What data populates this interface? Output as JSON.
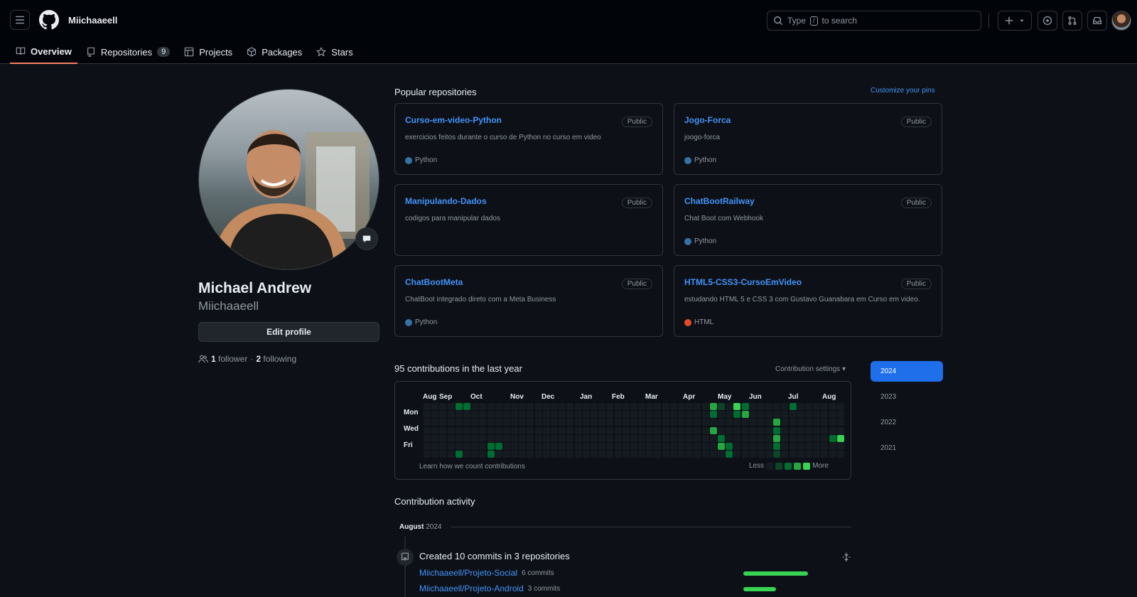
{
  "header": {
    "owner": "Miichaaeell",
    "search_prefix": "Type",
    "search_key": "/",
    "search_suffix": "to search"
  },
  "nav": {
    "overview": "Overview",
    "repositories": "Repositories",
    "repositories_count": "9",
    "projects": "Projects",
    "packages": "Packages",
    "stars": "Stars"
  },
  "profile": {
    "name": "Michael Andrew",
    "login": "Miichaaeell",
    "edit_label": "Edit profile",
    "followers": "1",
    "followers_label": "follower",
    "following": "2",
    "following_label": "following"
  },
  "popular": {
    "title": "Popular repositories",
    "customize": "Customize your pins",
    "repos": [
      {
        "name": "Curso-em-video-Python",
        "badge": "Public",
        "desc": "exercicios feitos durante o curso de Python no curso em video",
        "lang": "Python",
        "lang_color": "#3572A5"
      },
      {
        "name": "Jogo-Forca",
        "badge": "Public",
        "desc": "joogo-forca",
        "lang": "Python",
        "lang_color": "#3572A5"
      },
      {
        "name": "Manipulando-Dados",
        "badge": "Public",
        "desc": "codigos para manipular dados",
        "lang": "",
        "lang_color": ""
      },
      {
        "name": "ChatBootRailway",
        "badge": "Public",
        "desc": "Chat Boot com Webhook",
        "lang": "Python",
        "lang_color": "#3572A5"
      },
      {
        "name": "ChatBootMeta",
        "badge": "Public",
        "desc": "ChatBoot integrado direto com a Meta Business",
        "lang": "Python",
        "lang_color": "#3572A5"
      },
      {
        "name": "HTML5-CSS3-CursoEmVideo",
        "badge": "Public",
        "desc": "estudando HTML 5 e CSS 3 com Gustavo Guanabara em Curso em video.",
        "lang": "HTML",
        "lang_color": "#e34c26"
      }
    ]
  },
  "contributions": {
    "title": "95 contributions in the last year",
    "settings": "Contribution settings",
    "months": [
      "Aug",
      "Sep",
      "Oct",
      "Nov",
      "Dec",
      "Jan",
      "Feb",
      "Mar",
      "Apr",
      "May",
      "Jun",
      "Jul",
      "Aug"
    ],
    "days": [
      "Mon",
      "Wed",
      "Fri"
    ],
    "learn": "Learn how we count contributions",
    "less": "Less",
    "more": "More",
    "years": [
      "2024",
      "2023",
      "2022",
      "2021"
    ]
  },
  "activity": {
    "title": "Contribution activity",
    "month": "August",
    "year": "2024",
    "summary": "Created 10 commits in 3 repositories",
    "rows": [
      {
        "repo": "Miichaaeell/Projeto-Social",
        "commits": "6 commits",
        "share": 0.6
      },
      {
        "repo": "Miichaaeell/Projeto-Android",
        "commits": "3 commits",
        "share": 0.3
      }
    ]
  }
}
